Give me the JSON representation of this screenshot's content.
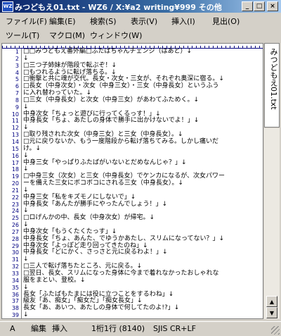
{
  "window": {
    "icon_label": "WZ",
    "title": "みつどもえ01.txt - WZ6 / X:¥a2 writing¥999 その他",
    "buttons": [
      "0",
      "1",
      "r"
    ]
  },
  "menu": {
    "row1": [
      "ファイル(F)",
      "編集(E)",
      "検索(S)",
      "表示(V)",
      "挿入(I)",
      "見出(O)"
    ],
    "row2": [
      "ツール(T)",
      "マクロ(M)",
      "ウィンドウ(W)"
    ]
  },
  "tab": {
    "label": "みつどもえ01.txt"
  },
  "editor": {
    "lines": [
      {
        "n": "1",
        "t": "□□みつどもえ番外編□ふたばちゃんチェンジ（はあと）↓"
      },
      {
        "n": "2",
        "t": "↓"
      },
      {
        "n": "3",
        "t": "□三つ子姉妹が階段で転ぶぞ！↓"
      },
      {
        "n": "4",
        "t": "□もつれるように転げ落ちる。↓"
      },
      {
        "n": "5",
        "t": "□衝撃と共に魂が交代。長女・次女・三女が、それぞれ奥深に宿る。↓"
      },
      {
        "n": "6",
        "t": "□長女（中身次女）・次女（中身三女）・三女（中身長女）というふう"
      },
      {
        "n": "7",
        "t": "に入れ替わっていた。↓"
      },
      {
        "n": "8",
        "t": "□三女（中身長女）と次女（中身三女）があわてふためく。↓"
      },
      {
        "n": "9",
        "t": "↓"
      },
      {
        "n": "10",
        "t": "中身次女「ちょっと遊びに行ってくるっす！」↓"
      },
      {
        "n": "11",
        "t": "中身長女「ちょ、あたしの身体で勝手に出かけないでよ！」↓"
      },
      {
        "n": "12",
        "t": "↓"
      },
      {
        "n": "13",
        "t": "□取り残された次女（中身三女）と三女（中身長女）。↓"
      },
      {
        "n": "14",
        "t": "□元に戻りないか、もう一度階段から転げ落ちてみる。しかし痛いだ"
      },
      {
        "n": "15",
        "t": "け。↓"
      },
      {
        "n": "16",
        "t": "↓"
      },
      {
        "n": "17",
        "t": "中身三女「やっぱりふたばがいないとだめなんじゃ？」↓"
      },
      {
        "n": "18",
        "t": "↓"
      },
      {
        "n": "19",
        "t": "□中身三女（次女）と三女（中身長女）でケンカになるが、次女パワー"
      },
      {
        "n": "20",
        "t": "ーを備えた三女にボコボコにされる三女（中身長女）。↓"
      },
      {
        "n": "21",
        "t": "↓"
      },
      {
        "n": "22",
        "t": "中身三女「私をキズモノにしないで」↓"
      },
      {
        "n": "23",
        "t": "中身長女「あんたが勝手にやったんでしょう！」↓"
      },
      {
        "n": "24",
        "t": "↓"
      },
      {
        "n": "25",
        "t": "□ロげんかの中、長女（中身次女）が帰宅。↓"
      },
      {
        "n": "26",
        "t": "↓"
      },
      {
        "n": "27",
        "t": "中身次女「もうくたくたっす」↓"
      },
      {
        "n": "28",
        "t": "中身長女「ちょ、あんた、でゆうかあたし、スリムになってない？」↓"
      },
      {
        "n": "29",
        "t": "中身次女「よっぽど走り回ってきたのね」↓"
      },
      {
        "n": "30",
        "t": "中身長女「どにかく、さっさと元に戻るわよ！」↓"
      },
      {
        "n": "31",
        "t": "↓"
      },
      {
        "n": "32",
        "t": "□三人で転げ落ちたところ、元に戻る。↓"
      },
      {
        "n": "33",
        "t": "□翌日、長女、スリムになった身体に今まで着れなかったおしゃれな"
      },
      {
        "n": "34",
        "t": "服をまとい、登校。↓"
      },
      {
        "n": "35",
        "t": "↓"
      },
      {
        "n": "36",
        "t": "長女「ふたばもたまには役に立つことをするわね」↓"
      },
      {
        "n": "37",
        "t": "級友「あ、痴女」「痴女だ」「痴女長女」↓"
      },
      {
        "n": "38",
        "t": "長女「あ、あいつ、あたしの身体で何してたのよ!?」↓"
      },
      {
        "n": "39",
        "t": "↓"
      }
    ]
  },
  "status": {
    "mode": "A",
    "edit": "編集",
    "insert": "挿入",
    "position": "1桁1行 (8140)",
    "encoding": "SJIS CR+LF"
  }
}
